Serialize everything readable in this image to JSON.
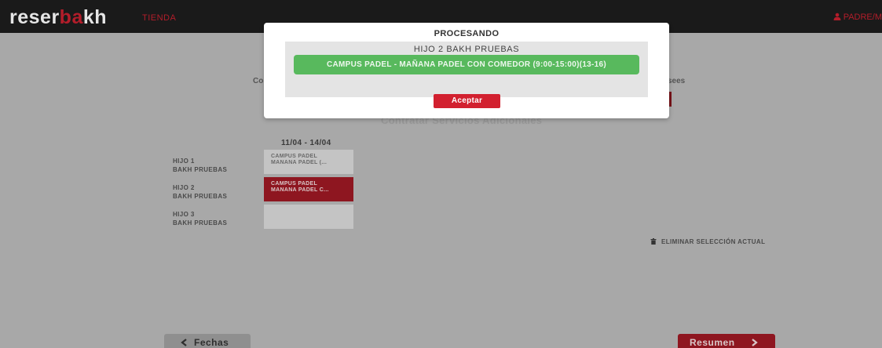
{
  "header": {
    "logo_part1": "reser",
    "logo_part2": "ba",
    "logo_part3": "kh",
    "shop_link": "TIENDA",
    "user_label": "PADRE/M",
    "brand_color": "#b31d2a"
  },
  "background": {
    "left_label": "Co",
    "right_label": "sees",
    "additional_services_title": "Contratar Servicios Adicionales",
    "week_header": "11/04 - 14/04",
    "children": [
      {
        "line1": "HIJO 1",
        "line2": "BAKH PRUEBAS",
        "cell_line1": "CAMPUS PADEL",
        "cell_line2": "MAÑANA PADEL (...",
        "selected": false
      },
      {
        "line1": "HIJO 2",
        "line2": "BAKH PRUEBAS",
        "cell_line1": "CAMPUS PADEL",
        "cell_line2": "MAÑANA PADEL C...",
        "selected": true
      },
      {
        "line1": "HIJO 3",
        "line2": "BAKH PRUEBAS",
        "cell_line1": "",
        "cell_line2": "",
        "selected": false
      }
    ],
    "delete_selection": "ELIMINAR SELECCIÓN ACTUAL"
  },
  "footer": {
    "back_label": "Fechas",
    "next_label": "Resumen"
  },
  "modal": {
    "title": "PROCESANDO",
    "child_name": "HIJO 2 BAKH PRUEBAS",
    "status_message": "CAMPUS PADEL - MAÑANA PADEL CON COMEDOR (9:00-15:00)(13-16)",
    "status_color": "#58b95d",
    "accept_label": "Aceptar"
  },
  "icons": [
    "user-icon",
    "trash-icon",
    "chevron-left-icon",
    "chevron-right-icon"
  ]
}
